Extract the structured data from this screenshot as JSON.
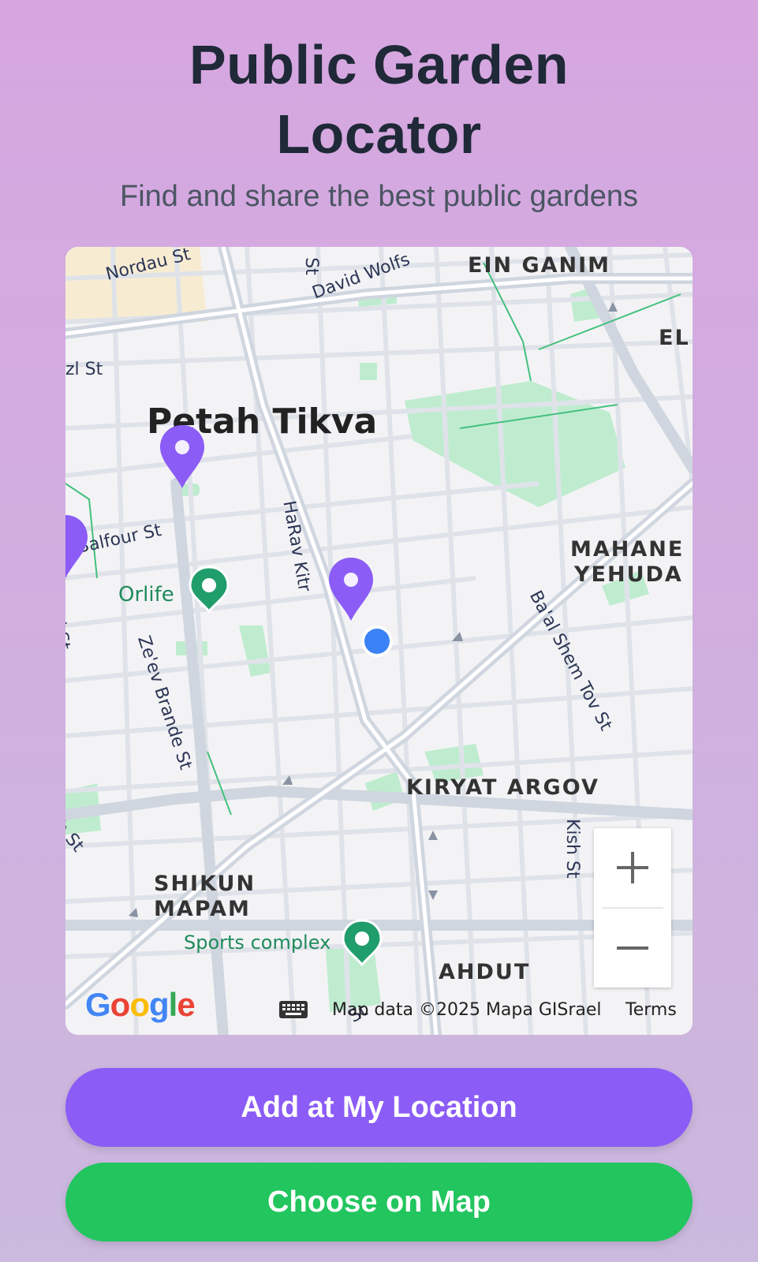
{
  "header": {
    "title_line1": "Public Garden",
    "title_line2": "Locator",
    "subtitle": "Find and share the best public gardens"
  },
  "map": {
    "city_label": "Petah Tikva",
    "districts": [
      "EIN GANIM",
      "EL",
      "MAHANE",
      "YEHUDA",
      "KIRYAT ARGOV",
      "SHIKUN",
      "MAPAM",
      "AHDUT"
    ],
    "streets": [
      "Nordau St",
      "David Wolfs",
      "St",
      "zl St",
      "HaRav Kitr",
      "Balfour St",
      "hild St",
      "Ze'ev Brande St",
      "Ba'al Shem Tov St",
      "Kish St",
      "ib St",
      "St"
    ],
    "pois": [
      "Orlife",
      "Sports complex"
    ],
    "zoom_in_label": "+",
    "zoom_out_label": "−",
    "logo_text": "Google",
    "attribution": "Map data ©2025 Mapa GISrael",
    "terms": "Terms",
    "colors": {
      "marker": "#8b5cf6",
      "poi": "#1f9d6b",
      "my_location": "#3b82f6",
      "park": "#bfeccf"
    }
  },
  "actions": {
    "add_location": "Add at My Location",
    "choose_on_map": "Choose on Map"
  },
  "colors": {
    "primary": "#8b5cf6",
    "success": "#22c55e",
    "title": "#1f2937"
  }
}
